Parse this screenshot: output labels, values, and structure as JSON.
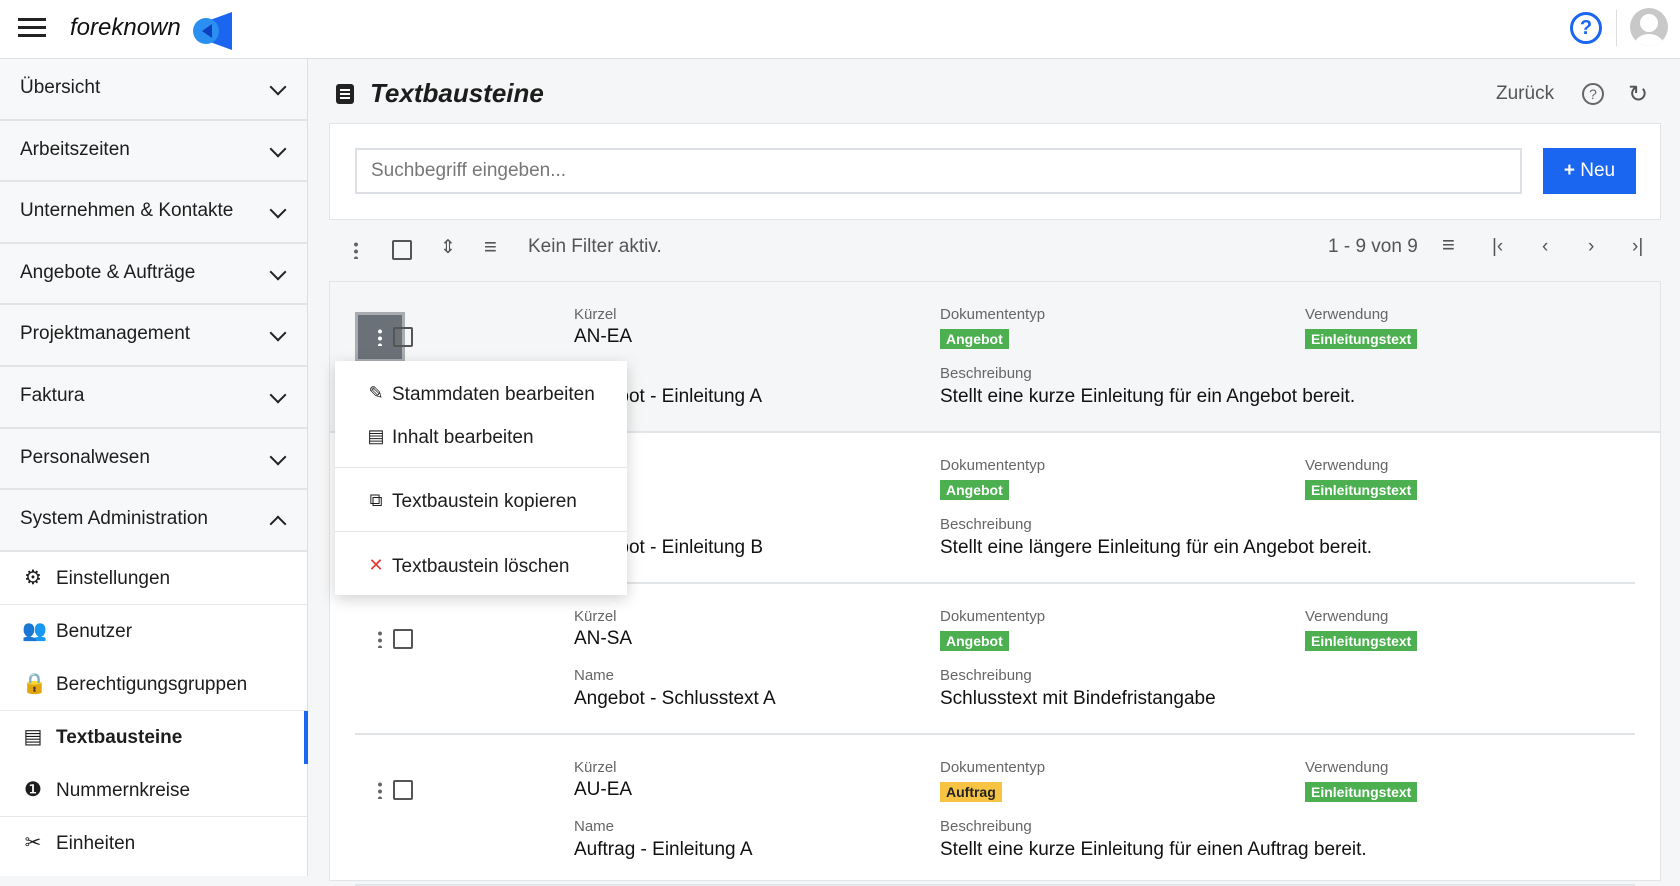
{
  "header": {
    "logo_text": "foreknown",
    "help_icon": "help-circle-icon",
    "avatar_icon": "user-avatar-icon"
  },
  "colors": {
    "accent": "#1a66f0",
    "badge_green": "#4caf50",
    "badge_yellow": "#f6c343"
  },
  "sidebar": {
    "groups": [
      {
        "label": "Übersicht",
        "expanded": false
      },
      {
        "label": "Arbeitszeiten",
        "expanded": false
      },
      {
        "label": "Unternehmen & Kontakte",
        "expanded": false
      },
      {
        "label": "Angebote & Aufträge",
        "expanded": false
      },
      {
        "label": "Projektmanagement",
        "expanded": false
      },
      {
        "label": "Faktura",
        "expanded": false
      },
      {
        "label": "Personalwesen",
        "expanded": false
      },
      {
        "label": "System Administration",
        "expanded": true
      }
    ],
    "items": [
      {
        "label": "Einstellungen",
        "icon": "gear-icon"
      },
      {
        "label": "Benutzer",
        "icon": "users-icon"
      },
      {
        "label": "Berechtigungsgruppen",
        "icon": "lock-icon"
      },
      {
        "label": "Textbausteine",
        "icon": "document-icon",
        "active": true
      },
      {
        "label": "Nummernkreise",
        "icon": "number-one-icon"
      },
      {
        "label": "Einheiten",
        "icon": "tools-icon"
      }
    ]
  },
  "page": {
    "title": "Textbausteine",
    "back": "Zurück"
  },
  "search": {
    "placeholder": "Suchbegriff eingeben...",
    "value": "",
    "new_label": "Neu"
  },
  "toolbar": {
    "filter_status": "Kein Filter aktiv.",
    "pagination": "1 - 9 von 9"
  },
  "labels": {
    "kuerzel": "Kürzel",
    "name": "Name",
    "dokumententyp": "Dokumententyp",
    "verwendung": "Verwendung",
    "beschreibung": "Beschreibung"
  },
  "rows": [
    {
      "kuerzel": "AN-EA",
      "name": "Angebot - Einleitung A",
      "dokumententyp": "Angebot",
      "doc_color": "green",
      "verwendung": "Einleitungstext",
      "beschreibung": "Stellt eine kurze Einleitung für ein Angebot bereit."
    },
    {
      "kuerzel": "",
      "name": "Angebot - Einleitung B",
      "dokumententyp": "Angebot",
      "doc_color": "green",
      "verwendung": "Einleitungstext",
      "beschreibung": "Stellt eine längere Einleitung für ein Angebot bereit."
    },
    {
      "kuerzel": "AN-SA",
      "name": "Angebot - Schlusstext A",
      "dokumententyp": "Angebot",
      "doc_color": "green",
      "verwendung": "Einleitungstext",
      "beschreibung": "Schlusstext mit Bindefristangabe"
    },
    {
      "kuerzel": "AU-EA",
      "name": "Auftrag - Einleitung A",
      "dokumententyp": "Auftrag",
      "doc_color": "yellow",
      "verwendung": "Einleitungstext",
      "beschreibung": "Stellt eine kurze Einleitung für einen Auftrag bereit."
    }
  ],
  "context_menu": {
    "items": [
      {
        "label": "Stammdaten bearbeiten",
        "icon": "pencil-icon"
      },
      {
        "label": "Inhalt bearbeiten",
        "icon": "document-icon"
      },
      {
        "label": "Textbaustein kopieren",
        "icon": "copy-icon"
      },
      {
        "label": "Textbaustein löschen",
        "icon": "close-icon"
      }
    ]
  }
}
